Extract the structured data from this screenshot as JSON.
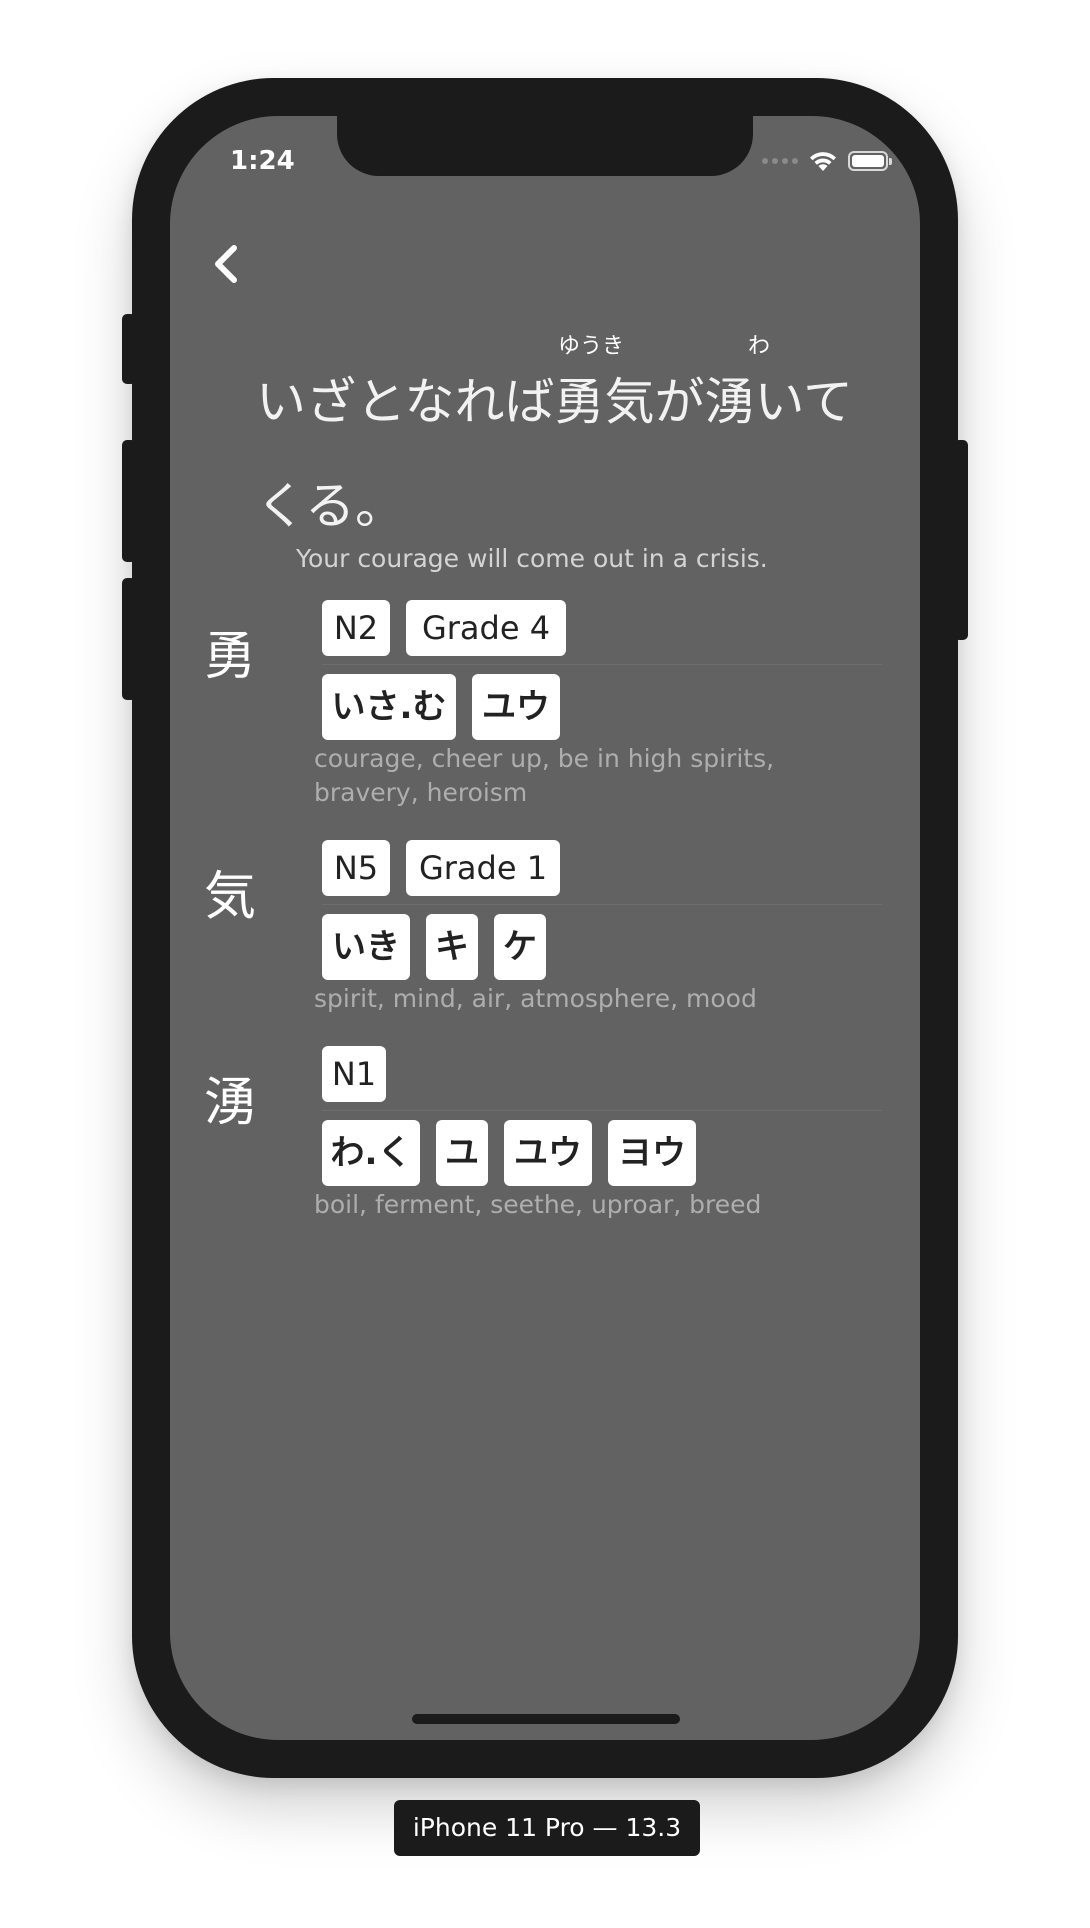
{
  "status_bar": {
    "time": "1:24"
  },
  "sentence": {
    "line1": "いざとなれば勇気が湧いて",
    "line2": "くる。",
    "furigana_1": "ゆうき",
    "furigana_2": "わ",
    "translation": "Your courage will come out in a crisis."
  },
  "kanji": [
    {
      "char": "勇",
      "tags": [
        "N2",
        "Grade 4"
      ],
      "readings": [
        "いさ.む",
        "ユウ"
      ],
      "meaning_line1": "courage, cheer up, be in high spirits,",
      "meaning_line2": "bravery, heroism"
    },
    {
      "char": "気",
      "tags": [
        "N5",
        "Grade 1"
      ],
      "readings": [
        "いき",
        "キ",
        "ケ"
      ],
      "meaning_line1": "spirit, mind, air, atmosphere, mood"
    },
    {
      "char": "湧",
      "tags": [
        "N1"
      ],
      "readings": [
        "わ.く",
        "ユ",
        "ユウ",
        "ヨウ"
      ],
      "meaning_line1": "boil, ferment, seethe, uproar, breed"
    }
  ],
  "device_label": "iPhone 11 Pro — 13.3",
  "colors": {
    "screen_bg": "#626262",
    "frame": "#1b1b1b",
    "chip_bg": "#ffffff"
  },
  "icons": {
    "back": "chevron-left-icon",
    "wifi": "wifi-icon",
    "battery": "battery-icon"
  }
}
